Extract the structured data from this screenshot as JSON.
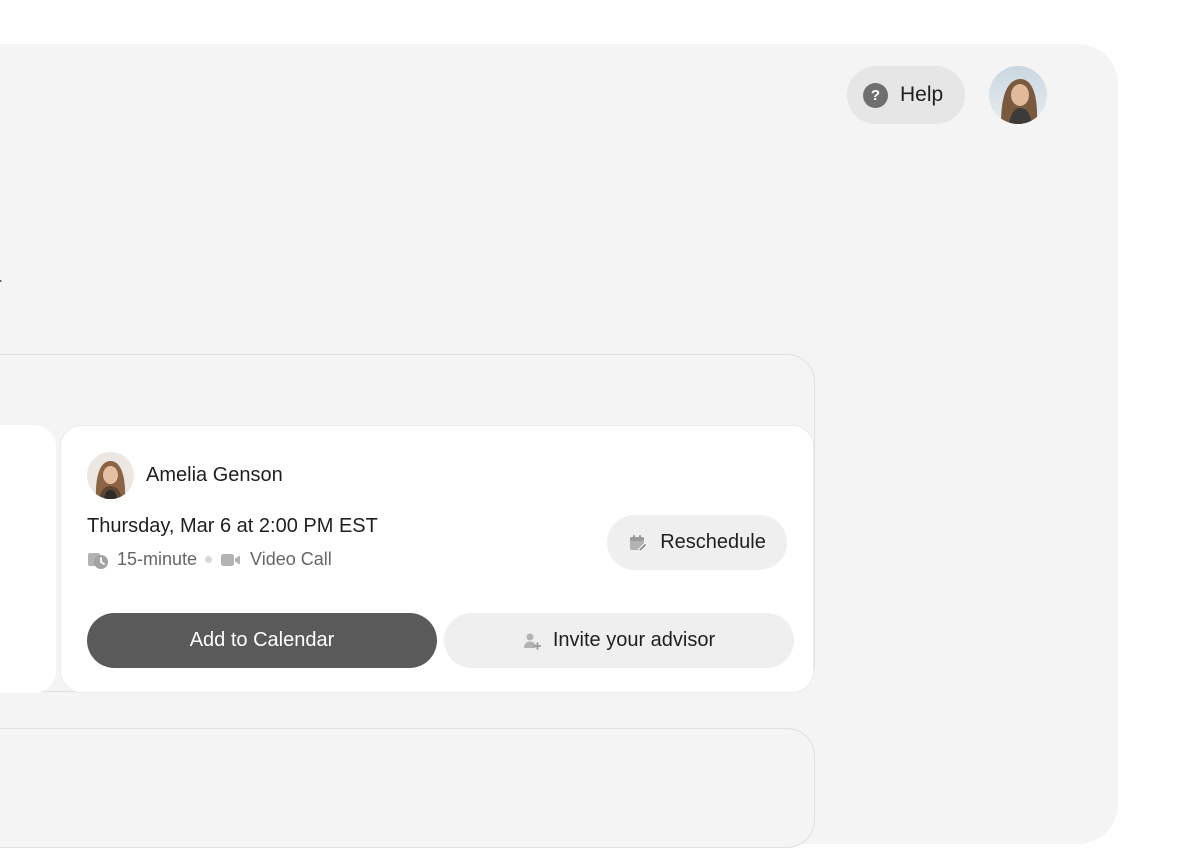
{
  "header": {
    "help_label": "Help",
    "help_icon_glyph": "?"
  },
  "page": {
    "stray_text": "."
  },
  "appointment": {
    "advisor_name": "Amelia Genson",
    "datetime": "Thursday, Mar 6 at 2:00 PM EST",
    "duration": "15-minute",
    "meeting_type": "Video Call",
    "reschedule_label": "Reschedule",
    "add_to_calendar_label": "Add to Calendar",
    "invite_label": "Invite your advisor"
  },
  "icons": {
    "help": "question-circle-icon",
    "duration": "clock-icon",
    "meeting_type": "video-camera-icon",
    "reschedule": "calendar-edit-icon",
    "invite": "add-user-icon"
  },
  "colors": {
    "panel_background": "#f4f4f4",
    "card_background": "#ffffff",
    "primary_button": "#5a5a5a",
    "secondary_button": "#efefef"
  }
}
